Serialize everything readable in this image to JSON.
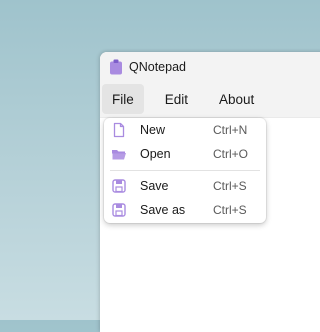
{
  "window": {
    "title": "QNotepad"
  },
  "menubar": {
    "items": [
      {
        "label": "File"
      },
      {
        "label": "Edit"
      },
      {
        "label": "About"
      }
    ]
  },
  "file_menu": {
    "items": [
      {
        "label": "New",
        "shortcut": "Ctrl+N",
        "icon": "new-file-icon"
      },
      {
        "label": "Open",
        "shortcut": "Ctrl+O",
        "icon": "open-folder-icon"
      },
      {
        "label": "Save",
        "shortcut": "Ctrl+S",
        "icon": "save-icon"
      },
      {
        "label": "Save as",
        "shortcut": "Ctrl+S",
        "icon": "save-as-icon"
      }
    ]
  },
  "colors": {
    "accent": "#a98be0",
    "titlebar": "#f3f3f3",
    "desktop": "#b6d1d8"
  }
}
